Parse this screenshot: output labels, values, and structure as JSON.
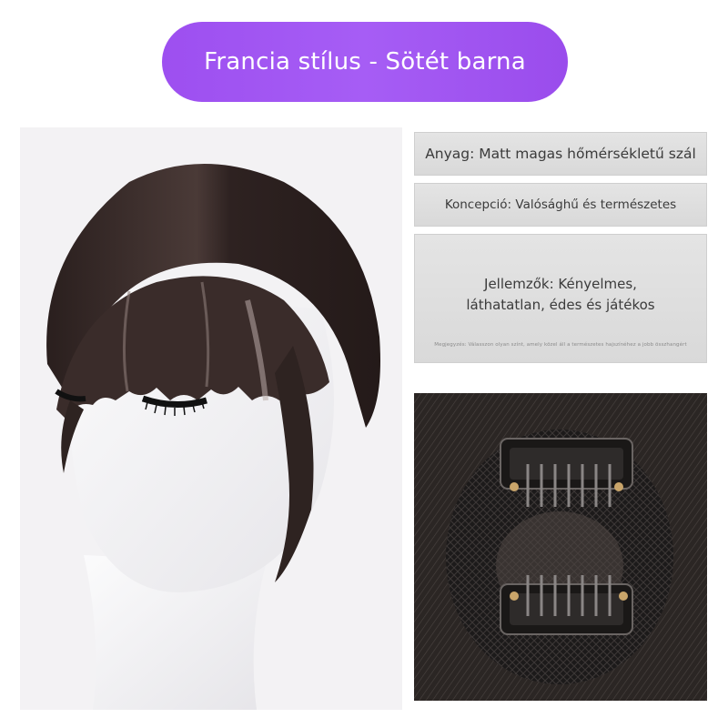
{
  "title": "Francia stílus - Sötét barna",
  "info": {
    "material": "Anyag: Matt magas hőmérsékletű szál",
    "concept": "Koncepció: Valósághű és természetes",
    "features": "Jellemzők: Kényelmes, láthatatlan, édes és játékos",
    "note": "Megjegyzés: Válasszon olyan színt, amely közel áll a természetes hajszínéhez a jobb összhangért"
  },
  "colors": {
    "accent": "#a35af3",
    "hair": "#2f2220",
    "panel": "#e0e0e0"
  },
  "images": {
    "left": "mannequin-head-with-dark-brown-bangs",
    "right": "hair-piece-back-with-two-clips"
  }
}
